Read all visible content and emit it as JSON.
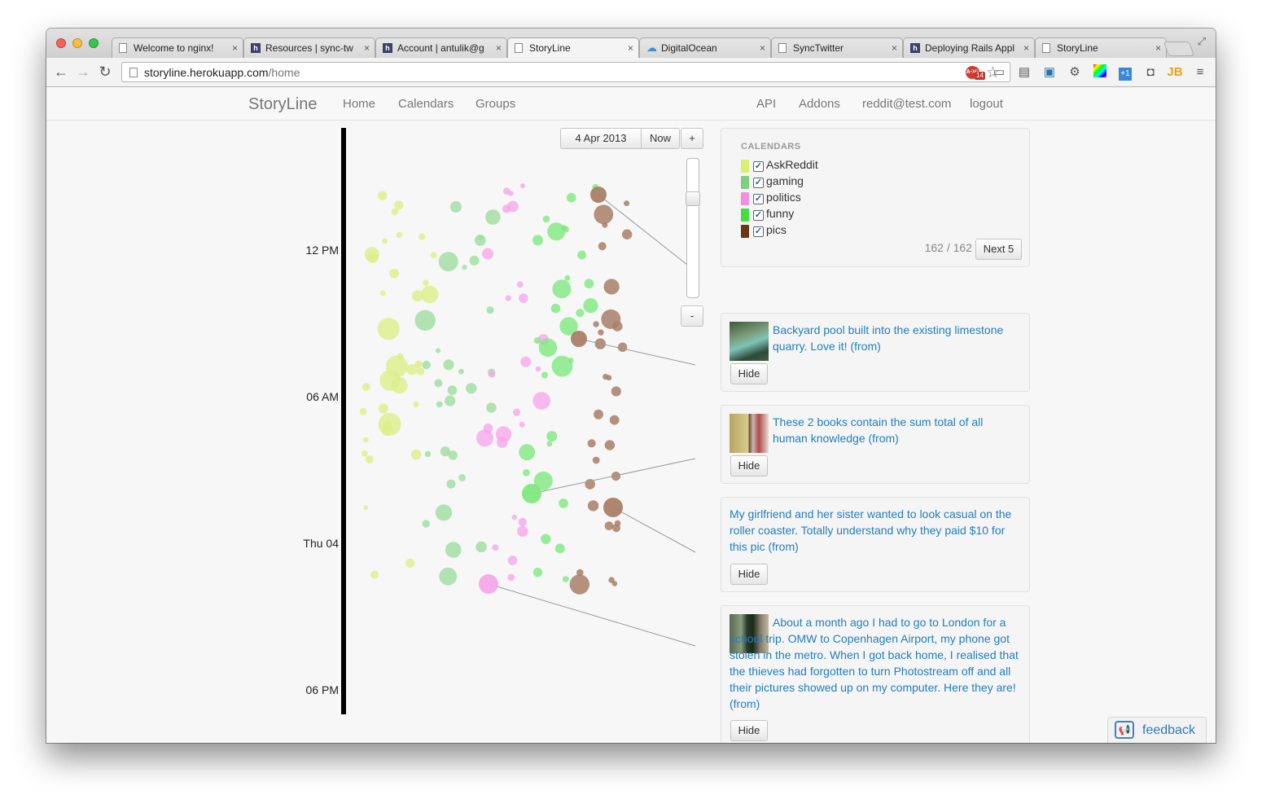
{
  "browser": {
    "tabs": [
      {
        "label": "Welcome to nginx!",
        "icon": "page-icon"
      },
      {
        "label": "Resources | sync-tw",
        "icon": "heroku-icon"
      },
      {
        "label": "Account | antulik@g",
        "icon": "heroku-icon"
      },
      {
        "label": "StoryLine",
        "icon": "page-icon",
        "active": true
      },
      {
        "label": "DigitalOcean",
        "icon": "cloud-icon"
      },
      {
        "label": "SyncTwitter",
        "icon": "page-icon"
      },
      {
        "label": "Deploying Rails Appl",
        "icon": "heroku-icon"
      },
      {
        "label": "StoryLine",
        "icon": "page-icon"
      }
    ],
    "url_host": "storyline.herokuapp.com",
    "url_path": "/home",
    "abp_label": "ABP",
    "ext_badge": "14"
  },
  "nav": {
    "brand": "StoryLine",
    "links": [
      "Home",
      "Calendars",
      "Groups"
    ],
    "right_links": [
      "API",
      "Addons",
      "reddit@test.com",
      "logout"
    ]
  },
  "timeline": {
    "date_label": "4 Apr 2013",
    "now_label": "Now",
    "zoom_in": "+",
    "zoom_out": "-",
    "ticks": [
      "12 PM",
      "06 AM",
      "Thu 04",
      "06 PM"
    ]
  },
  "calendars": {
    "title": "CALENDARS",
    "items": [
      {
        "name": "AskReddit",
        "color": "#d9ef6e",
        "checked": true
      },
      {
        "name": "gaming",
        "color": "#7ed07e",
        "checked": true
      },
      {
        "name": "politics",
        "color": "#f38ee0",
        "checked": true
      },
      {
        "name": "funny",
        "color": "#3fe03f",
        "checked": true
      },
      {
        "name": "pics",
        "color": "#6b3513",
        "checked": true
      }
    ],
    "count": "162 / 162",
    "next_label": "Next 5"
  },
  "posts": [
    {
      "title": "Backyard pool built into the existing limestone quarry. Love it! (from)",
      "hide": "Hide",
      "thumb": "pool-thumbnail"
    },
    {
      "title": "These 2 books contain the sum total of all human knowledge (from)",
      "hide": "Hide",
      "thumb": "books-thumbnail"
    },
    {
      "title": "My girlfriend and her sister wanted to look casual on the roller coaster. Totally understand why they paid $10 for this pic (from)",
      "hide": "Hide"
    },
    {
      "title": "About a month ago I had to go to London for a school trip. OMW to Copenhagen Airport, my phone got stolen in the metro. When I got back home, I realised that the thieves had forgotten to turn Photostream off and all their pictures showed up on my computer. Here they are! (from)",
      "hide": "Hide",
      "thumb": "person-thumbnail"
    }
  ],
  "feedback": {
    "label": "feedback",
    "icon": "megaphone-icon"
  }
}
